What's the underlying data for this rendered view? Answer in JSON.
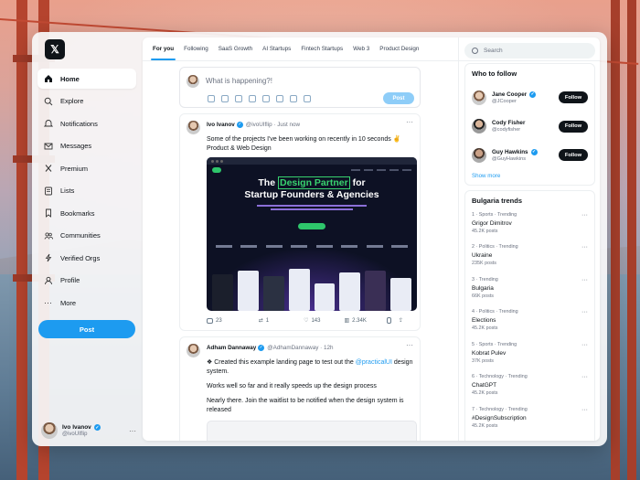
{
  "sidebar": {
    "logo": "𝕏",
    "items": [
      {
        "label": "Home",
        "icon": "home-icon"
      },
      {
        "label": "Explore",
        "icon": "search-icon"
      },
      {
        "label": "Notifications",
        "icon": "bell-icon"
      },
      {
        "label": "Messages",
        "icon": "mail-icon"
      },
      {
        "label": "Premium",
        "icon": "x-icon"
      },
      {
        "label": "Lists",
        "icon": "list-icon"
      },
      {
        "label": "Bookmarks",
        "icon": "bookmark-icon"
      },
      {
        "label": "Communities",
        "icon": "people-icon"
      },
      {
        "label": "Verified Orgs",
        "icon": "bolt-icon"
      },
      {
        "label": "Profile",
        "icon": "user-icon"
      },
      {
        "label": "More",
        "icon": "more-icon"
      }
    ],
    "post_label": "Post",
    "profile": {
      "name": "Ivo Ivanov",
      "handle": "@ivoUIflip"
    }
  },
  "tabs": [
    "For you",
    "Following",
    "SaaS Growth",
    "AI Startups",
    "Fintech Startups",
    "Web 3",
    "Product Design"
  ],
  "composer": {
    "placeholder": "What is happening?!",
    "post_label": "Post"
  },
  "posts": [
    {
      "author": "Ivo Ivanov",
      "handle": "@ivoUIflip",
      "time": "· Just now",
      "text": "Some of the projects I've been working on recently in 10 seconds ✌ Product & Web Design",
      "media": {
        "brand": "flip",
        "headline_pre": "The",
        "headline_hl": "Design Partner",
        "headline_post": "for",
        "headline_line2": "Startup Founders & Agencies"
      },
      "stats": {
        "replies": "23",
        "reposts": "1",
        "likes": "143",
        "views": "2.34K"
      }
    },
    {
      "author": "Adham Dannaway",
      "handle": "@AdhamDannaway",
      "time": "· 12h",
      "text_pre": "❖ Created this example landing page to test out the",
      "mention": "@practicalUI",
      "text_post": "design system.",
      "line2": "Works well so far and it really speeds up the design process",
      "line3": "Nearly there. Join the waitlist to be notified when the design system is released"
    }
  ],
  "right": {
    "search_placeholder": "Search",
    "who_title": "Who to follow",
    "who": [
      {
        "name": "Jane Cooper",
        "handle": "@JCooper",
        "button": "Follow"
      },
      {
        "name": "Cody Fisher",
        "handle": "@codyfisher",
        "button": "Follow"
      },
      {
        "name": "Guy Hawkins",
        "handle": "@GuyHawkins",
        "button": "Follow"
      }
    ],
    "show_more": "Show more",
    "trends_title": "Bulgaria trends",
    "trends": [
      {
        "cat": "1 · Sports · Trending",
        "title": "Grigor Dimitrov",
        "count": "45.2K posts"
      },
      {
        "cat": "2 · Politics · Trending",
        "title": "Ukraine",
        "count": "235K posts"
      },
      {
        "cat": "3 · Trending",
        "title": "Bulgaria",
        "count": "66K posts"
      },
      {
        "cat": "4 · Politics · Trending",
        "title": "Elections",
        "count": "45.2K posts"
      },
      {
        "cat": "5 · Sports · Trending",
        "title": "Kobrat Pulev",
        "count": "37K posts"
      },
      {
        "cat": "6 · Technology · Trending",
        "title": "ChatGPT",
        "count": "45.2K posts"
      },
      {
        "cat": "7 · Technology · Trending",
        "title": "#DesignSubscription",
        "count": "45.2K posts"
      }
    ]
  },
  "colors": {
    "accent": "#1d9bf0",
    "dark": "#0f1419",
    "bridge": "#b5442e"
  }
}
